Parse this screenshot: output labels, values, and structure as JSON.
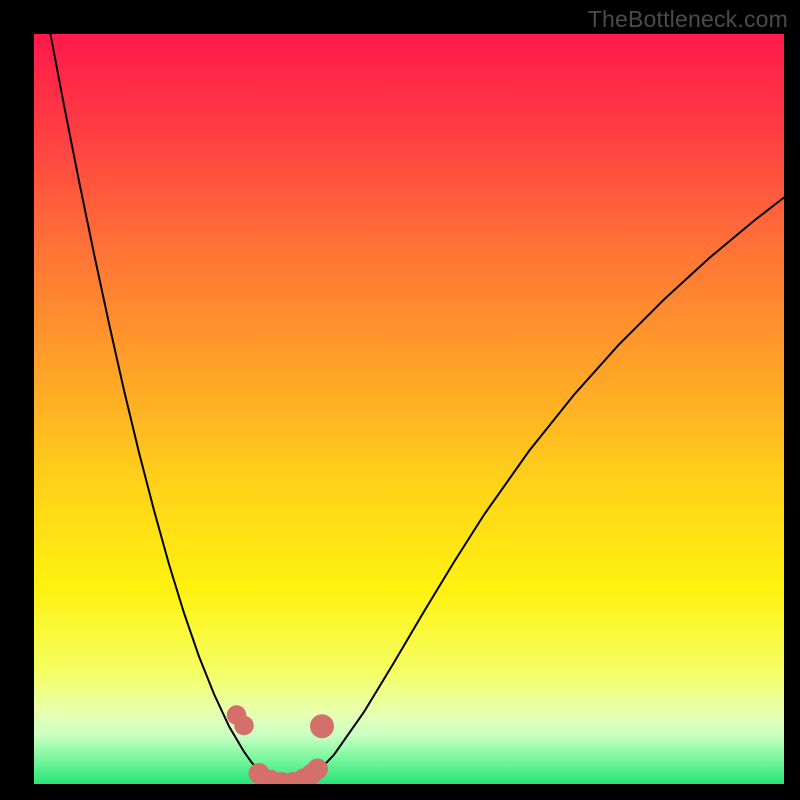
{
  "watermark": "TheBottleneck.com",
  "chart_data": {
    "type": "line",
    "title": "",
    "xlabel": "",
    "ylabel": "",
    "xlim": [
      0,
      100
    ],
    "ylim": [
      0,
      100
    ],
    "grid": false,
    "series": [
      {
        "name": "curve",
        "color": "#000000",
        "x": [
          0,
          2,
          4,
          6,
          8,
          10,
          12,
          14,
          16,
          18,
          20,
          22,
          24,
          26,
          28,
          29,
          30,
          31,
          32,
          33,
          34,
          35,
          36,
          38,
          40,
          44,
          48,
          52,
          56,
          60,
          66,
          72,
          78,
          84,
          90,
          96,
          100
        ],
        "values": [
          112,
          101,
          90.5,
          80.4,
          70.7,
          61.4,
          52.5,
          44.2,
          36.5,
          29.3,
          22.8,
          17.0,
          12.0,
          7.7,
          4.3,
          2.9,
          1.8,
          1.0,
          0.4,
          0.1,
          0.0,
          0.1,
          0.5,
          1.8,
          3.9,
          9.6,
          16.2,
          23.0,
          29.6,
          35.9,
          44.4,
          51.9,
          58.6,
          64.6,
          70.1,
          75.1,
          78.2
        ]
      }
    ],
    "markers": [
      {
        "x": 27.0,
        "y": 9.2,
        "r": 1.3
      },
      {
        "x": 28.0,
        "y": 7.8,
        "r": 1.3
      },
      {
        "x": 30.0,
        "y": 1.4,
        "r": 1.4
      },
      {
        "x": 31.5,
        "y": 0.5,
        "r": 1.4
      },
      {
        "x": 33.0,
        "y": 0.2,
        "r": 1.4
      },
      {
        "x": 34.5,
        "y": 0.2,
        "r": 1.4
      },
      {
        "x": 36.0,
        "y": 0.7,
        "r": 1.4
      },
      {
        "x": 37.0,
        "y": 1.3,
        "r": 1.4
      },
      {
        "x": 37.8,
        "y": 2.0,
        "r": 1.4
      },
      {
        "x": 38.4,
        "y": 7.7,
        "r": 1.6
      }
    ],
    "marker_color": "#d56f6c",
    "gradient_stops": [
      {
        "offset": 0.0,
        "color": "#ff1a4b"
      },
      {
        "offset": 0.12,
        "color": "#ff3a44"
      },
      {
        "offset": 0.28,
        "color": "#ff7137"
      },
      {
        "offset": 0.44,
        "color": "#ffa029"
      },
      {
        "offset": 0.6,
        "color": "#ffd21a"
      },
      {
        "offset": 0.74,
        "color": "#fff210"
      },
      {
        "offset": 0.85,
        "color": "#f5ff63"
      },
      {
        "offset": 0.905,
        "color": "#e8ffb0"
      },
      {
        "offset": 0.935,
        "color": "#caffc4"
      },
      {
        "offset": 0.965,
        "color": "#7cf8a0"
      },
      {
        "offset": 1.0,
        "color": "#27e57a"
      }
    ]
  }
}
